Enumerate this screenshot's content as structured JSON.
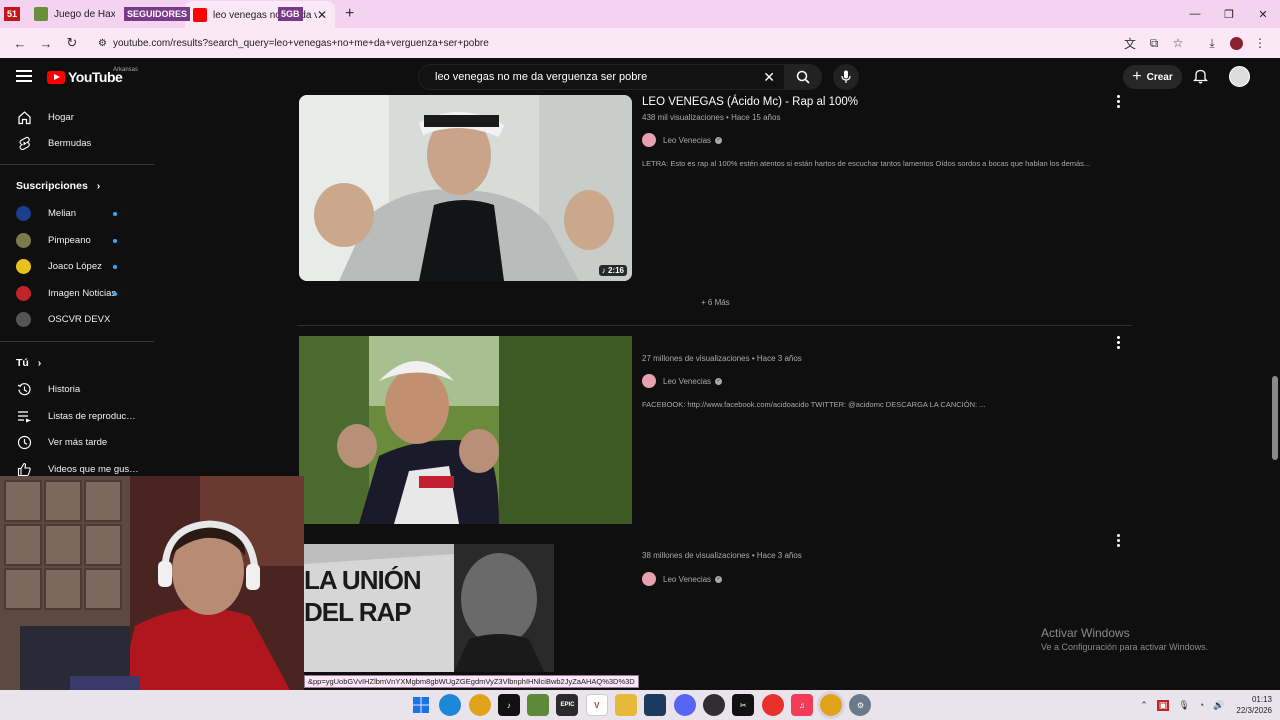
{
  "browser": {
    "tabs": [
      {
        "label": "Juego de Haxball",
        "active": false
      },
      {
        "label": "leo venegas no me da verguenza",
        "active": true
      }
    ],
    "overlay_left": {
      "count": "51",
      "label": "SEGUIDORES",
      "right_count": "5GB"
    },
    "address": "youtube.com/results?search_query=leo+venegas+no+me+da+verguenza+ser+pobre"
  },
  "youtube": {
    "logo_text": "YouTube",
    "country_code": "Arkansas",
    "search_query": "leo venegas no me da verguenza ser pobre",
    "create_label": "Crear",
    "sidebar": {
      "main": [
        {
          "label": "Hogar",
          "icon": "home-icon"
        },
        {
          "label": "Bermudas",
          "icon": "shorts-icon"
        }
      ],
      "subscriptions_title": "Suscripciones",
      "subscriptions": [
        {
          "label": "Melian",
          "color": "#1b3e8f",
          "new": true
        },
        {
          "label": "Pimpeano",
          "color": "#7a7a4a",
          "new": true
        },
        {
          "label": "Joaco López",
          "color": "#e6c21a",
          "new": true
        },
        {
          "label": "Imagen Noticias",
          "color": "#c2232b",
          "new": true
        },
        {
          "label": "OSCVR DEVX",
          "color": "#555555",
          "new": false
        }
      ],
      "you_title": "Tú",
      "you": [
        {
          "label": "Historia",
          "icon": "history-icon"
        },
        {
          "label": "Listas de reproduc…",
          "icon": "playlists-icon"
        },
        {
          "label": "Ver más tarde",
          "icon": "watch-later-icon"
        },
        {
          "label": "Videos que me gus…",
          "icon": "liked-icon"
        }
      ]
    },
    "results": [
      {
        "title": "LEO VENEGAS (Ácido Mc) - Rap al 100%",
        "views": "438 mil visualizaciones",
        "age": "Hace 15 años",
        "channel": "Leo Venecias",
        "description": "LETRA: Esto es rap al 100% estén atentos si están hartos de escuchar tantos lamentos Oídos sordos a bocas que hablan los demás...",
        "duration": "2:16"
      },
      {
        "title": "",
        "views": "27 millones de visualizaciones",
        "age": "Hace 3 años",
        "channel": "Leo Venecias",
        "description": "FACEBOOK: http://www.facebook.com/acidoacido TWITTER: @acidomc DESCARGA LA CANCIÓN: ..."
      },
      {
        "title": "",
        "views": "38 millones de visualizaciones",
        "age": "Hace 3 años",
        "channel": "Leo Venecias",
        "description": "",
        "thumb_text": "LA UNIÓN DEL RAP"
      }
    ],
    "more_label": "+ 6 Más",
    "url_tooltip": "&pp=ygUobGVvIHZlbmVnYXMgbm8gbWUgZGEgdmVyZ3VlbnphIHNlciBwb2JyZaAHAQ%3D%3D"
  },
  "windows": {
    "activate_title": "Activar Windows",
    "activate_sub": "Ve a Configuración para activar Windows.",
    "time": "01:13",
    "date": "22/3/2026"
  }
}
